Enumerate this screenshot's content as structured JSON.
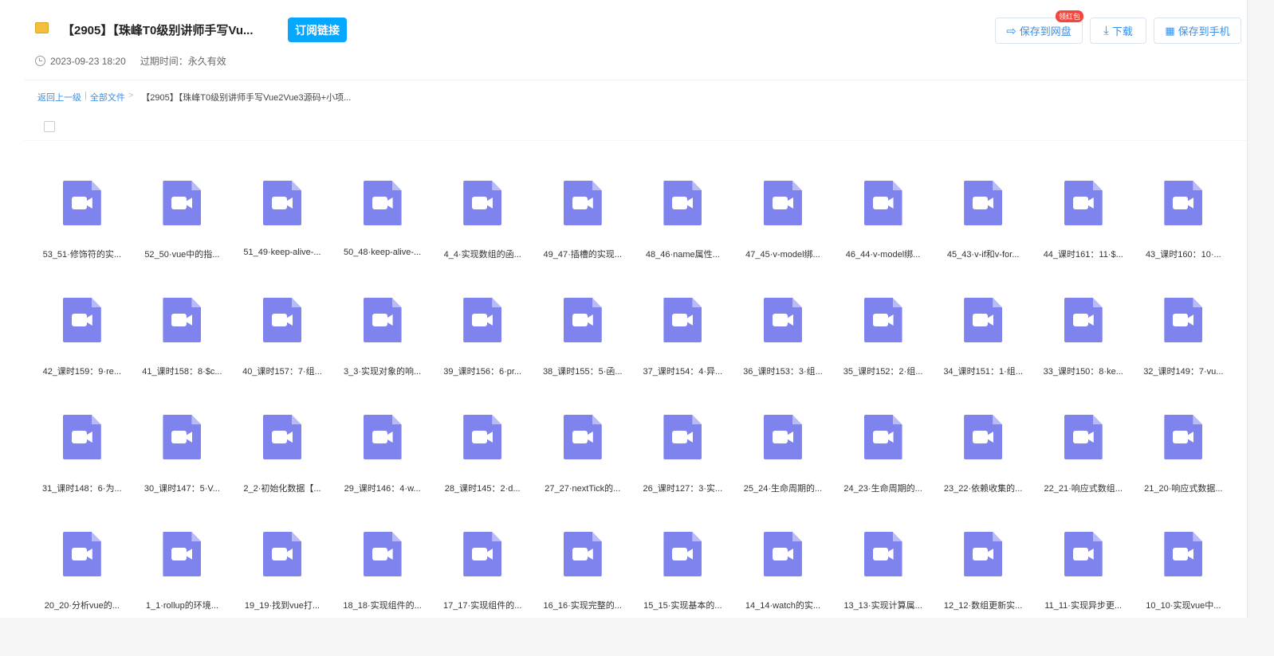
{
  "header": {
    "title": "【2905】【珠峰T0级别讲师手写Vu...",
    "subscribe": "订阅链接",
    "date": "2023-09-23 18:20",
    "expire": "过期时间：永久有效"
  },
  "actions": {
    "save_disk": "保存到网盘",
    "badge": "领红包",
    "download": "下载",
    "save_phone": "保存到手机"
  },
  "breadcrumb": {
    "back": "返回上一级",
    "all": "全部文件",
    "sep": ">",
    "current": "【2905】【珠峰T0级别讲师手写Vue2Vue3源码+小项..."
  },
  "files": [
    "53_51·修饰符的实...",
    "52_50·vue中的指...",
    "51_49·keep-alive-...",
    "50_48·keep-alive-...",
    "4_4·实现数组的函...",
    "49_47·插槽的实现...",
    "48_46·name属性...",
    "47_45·v-model绑...",
    "46_44·v-model绑...",
    "45_43·v-if和v-for...",
    "44_课时161：11·$...",
    "43_课时160：10·...",
    "42_课时159：9·re...",
    "41_课时158：8·$c...",
    "40_课时157：7·组...",
    "3_3·实现对象的响...",
    "39_课时156：6·pr...",
    "38_课时155：5·函...",
    "37_课时154：4·异...",
    "36_课时153：3·组...",
    "35_课时152：2·组...",
    "34_课时151：1·组...",
    "33_课时150：8·ke...",
    "32_课时149：7·vu...",
    "31_课时148：6·为...",
    "30_课时147：5·V...",
    "2_2·初始化数据【...",
    "29_课时146：4·w...",
    "28_课时145：2·d...",
    "27_27·nextTick的...",
    "26_课时127：3·实...",
    "25_24·生命周期的...",
    "24_23·生命周期的...",
    "23_22·依赖收集的...",
    "22_21·响应式数组...",
    "21_20·响应式数据...",
    "20_20·分析vue的...",
    "1_1·rollup的环境...",
    "19_19·找到vue打...",
    "18_18·实现组件的...",
    "17_17·实现组件的...",
    "16_16·实现完整的...",
    "15_15·实现基本的...",
    "14_14·watch的实...",
    "13_13·实现计算属...",
    "12_12·数组更新实...",
    "11_11·实现异步更...",
    "10_10·实现vue中..."
  ]
}
